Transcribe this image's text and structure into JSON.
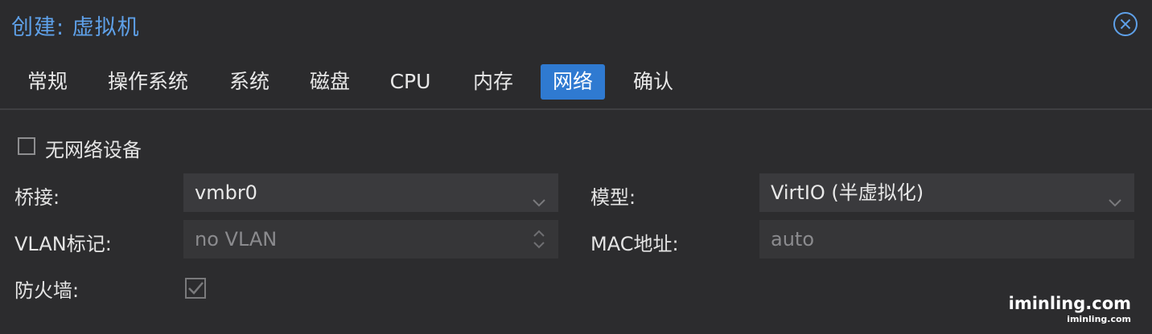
{
  "window": {
    "title": "创建: 虚拟机",
    "close_icon": "close-circle-x-icon",
    "accent_color": "#5ea0e8"
  },
  "tabs": [
    {
      "label": "常规",
      "active": false
    },
    {
      "label": "操作系统",
      "active": false
    },
    {
      "label": "系统",
      "active": false
    },
    {
      "label": "磁盘",
      "active": false
    },
    {
      "label": "CPU",
      "active": false
    },
    {
      "label": "内存",
      "active": false
    },
    {
      "label": "网络",
      "active": true
    },
    {
      "label": "确认",
      "active": false
    }
  ],
  "active_tab_color": "#2f7ad1",
  "network": {
    "no_network_device": {
      "label": "无网络设备",
      "checked": false
    },
    "bridge": {
      "label": "桥接:",
      "value": "vmbr0"
    },
    "model": {
      "label": "模型:",
      "value": "VirtIO (半虚拟化)"
    },
    "vlan_tag": {
      "label": "VLAN标记:",
      "placeholder": "no VLAN"
    },
    "mac_address": {
      "label": "MAC地址:",
      "placeholder": "auto"
    },
    "firewall": {
      "label": "防火墙:",
      "checked": true
    }
  },
  "watermark": {
    "large": "iminling.com",
    "small": "iminling.com"
  }
}
